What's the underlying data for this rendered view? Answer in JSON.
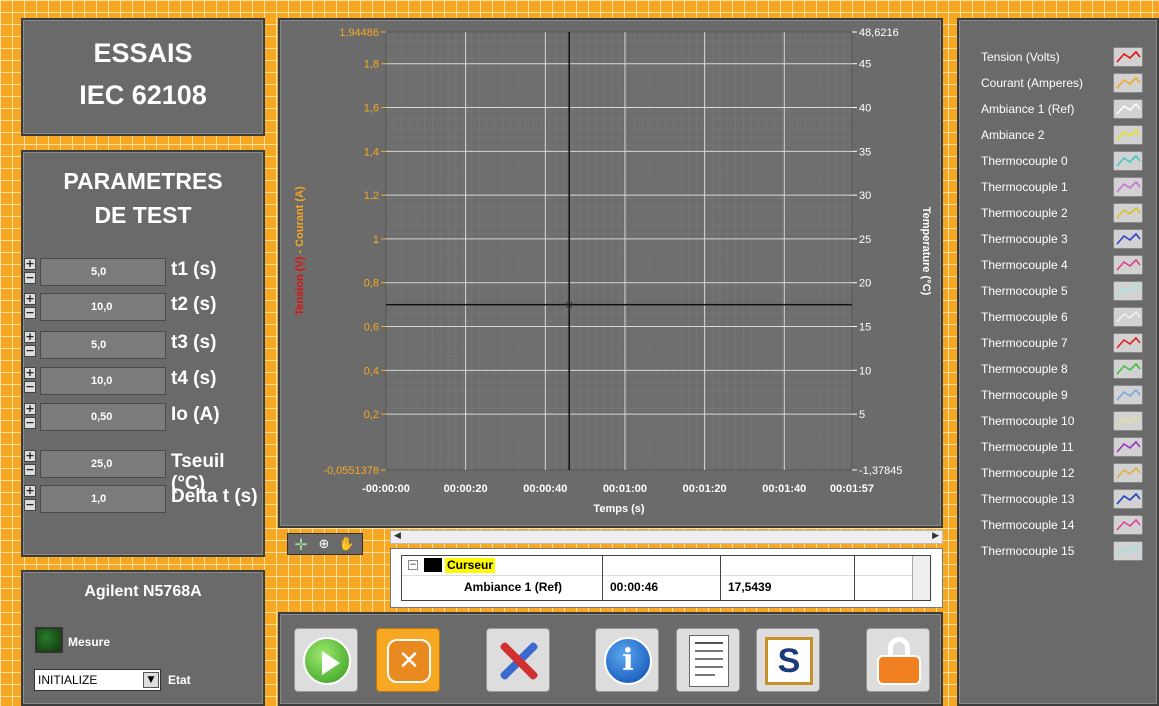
{
  "title": {
    "line1": "ESSAIS",
    "line2": "IEC 62108"
  },
  "params": {
    "heading1": "PARAMETRES",
    "heading2": "DE TEST",
    "items": [
      {
        "value": "5,0",
        "label": "t1 (s)"
      },
      {
        "value": "10,0",
        "label": "t2 (s)"
      },
      {
        "value": "5,0",
        "label": "t3 (s)"
      },
      {
        "value": "10,0",
        "label": "t4 (s)"
      },
      {
        "value": "0,50",
        "label": "Io (A)"
      },
      {
        "value": "25,0",
        "label": "Tseuil (°C)"
      },
      {
        "value": "1,0",
        "label": "Delta t (s)"
      }
    ]
  },
  "device": {
    "name": "Agilent N5768A",
    "led_label": "Mesure",
    "state_value": "INITIALIZE",
    "state_label": "Etat"
  },
  "chart_data": {
    "type": "line",
    "xlabel": "Temps (s)",
    "ylabel_left_part1": "Tension (V)",
    "ylabel_left_sep": " - ",
    "ylabel_left_part2": "Courant (A)",
    "ylabel_right": "Temperature (°C)",
    "xlim": [
      "-00:00:00",
      "00:01:57"
    ],
    "ylim_left": [
      -0.0551378,
      1.94486
    ],
    "ylim_right": [
      -1.37845,
      48.6216
    ],
    "x_ticks": [
      "-00:00:00",
      "00:00:20",
      "00:00:40",
      "00:01:00",
      "00:01:20",
      "00:01:40",
      "00:01:57"
    ],
    "x_tick_values": [
      0,
      20,
      40,
      60,
      80,
      100,
      117
    ],
    "left_ticks": [
      "1,94486",
      "1,8",
      "1,6",
      "1,4",
      "1,2",
      "1",
      "0,8",
      "0,6",
      "0,4",
      "0,2",
      "-0,0551378"
    ],
    "left_tick_values": [
      1.94486,
      1.8,
      1.6,
      1.4,
      1.2,
      1,
      0.8,
      0.6,
      0.4,
      0.2,
      -0.0551378
    ],
    "right_ticks": [
      "48,6216",
      "45",
      "40",
      "35",
      "30",
      "25",
      "20",
      "15",
      "10",
      "5",
      "-1,37845"
    ],
    "right_tick_values": [
      48.6216,
      45,
      40,
      35,
      30,
      25,
      20,
      15,
      10,
      5,
      -1.37845
    ],
    "cursor": {
      "x": 46,
      "y": 0.7
    },
    "colors": {
      "left_axis": "#f7a823",
      "ylabel_left_part1": "#e01010",
      "ylabel_left_part2": "#f7a823",
      "right_axis": "#ffffff",
      "cursor": "#111111",
      "grid": "#9a9a9a",
      "background": "#6b6b6b"
    },
    "series": []
  },
  "cursor_table": {
    "header": "Curseur",
    "rows": [
      {
        "name": "Ambiance 1 (Ref)",
        "time": "00:00:46",
        "value": "17,5439"
      }
    ]
  },
  "legend": [
    {
      "label": "Tension (Volts)",
      "color": "#e01010"
    },
    {
      "label": "Courant (Amperes)",
      "color": "#f7a823"
    },
    {
      "label": "Ambiance 1 (Ref)",
      "color": "#ffffff"
    },
    {
      "label": "Ambiance 2",
      "color": "#e8e020"
    },
    {
      "label": "Thermocouple 0",
      "color": "#40c8c0"
    },
    {
      "label": "Thermocouple 1",
      "color": "#c870d8"
    },
    {
      "label": "Thermocouple 2",
      "color": "#e0c020"
    },
    {
      "label": "Thermocouple 3",
      "color": "#3040d0"
    },
    {
      "label": "Thermocouple 4",
      "color": "#e04080"
    },
    {
      "label": "Thermocouple 5",
      "color": "#a8e8e8"
    },
    {
      "label": "Thermocouple 6",
      "color": "#f0f0f0"
    },
    {
      "label": "Thermocouple 7",
      "color": "#e02020"
    },
    {
      "label": "Thermocouple 8",
      "color": "#40c040"
    },
    {
      "label": "Thermocouple 9",
      "color": "#70a8e8"
    },
    {
      "label": "Thermocouple 10",
      "color": "#e0e0a0"
    },
    {
      "label": "Thermocouple 11",
      "color": "#a030c0"
    },
    {
      "label": "Thermocouple 12",
      "color": "#e0b040"
    },
    {
      "label": "Thermocouple 13",
      "color": "#2040c0"
    },
    {
      "label": "Thermocouple 14",
      "color": "#e040a0"
    },
    {
      "label": "Thermocouple 15",
      "color": "#a0e0e0"
    }
  ],
  "toolbar": [
    {
      "icon": "play-icon"
    },
    {
      "icon": "stop-icon"
    },
    {
      "icon": "tools-icon"
    },
    {
      "icon": "info-icon"
    },
    {
      "icon": "report-icon"
    },
    {
      "icon": "logo-s-icon"
    },
    {
      "icon": "lock-icon"
    }
  ]
}
